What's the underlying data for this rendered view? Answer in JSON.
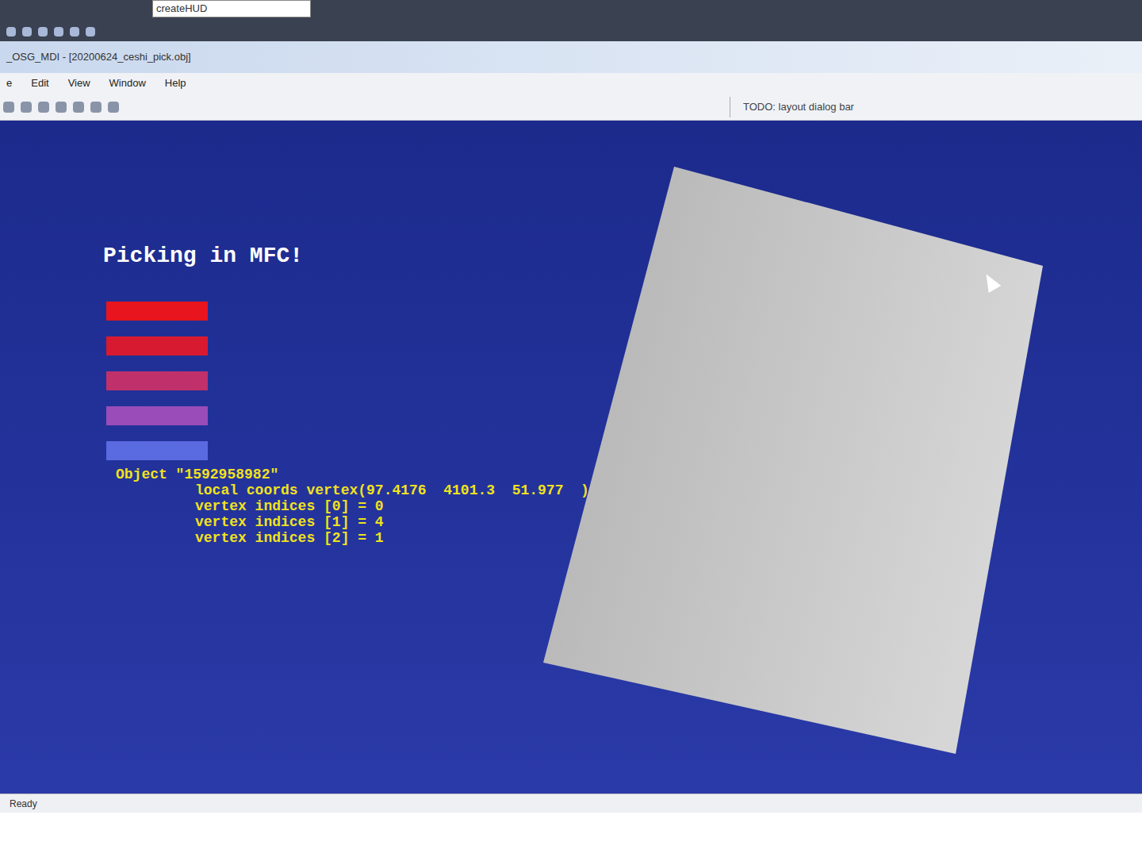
{
  "toolbar_top": {
    "combo": "createHUD"
  },
  "window": {
    "title": "_OSG_MDI - [20200624_ceshi_pick.obj]"
  },
  "menu": [
    "e",
    "Edit",
    "View",
    "Window",
    "Help"
  ],
  "dialog_bar": "TODO: layout dialog bar",
  "hud": {
    "title": "Picking in MFC!",
    "bars": [
      {
        "color": "#e8141e"
      },
      {
        "color": "#d81a30"
      },
      {
        "color": "#c0306a"
      },
      {
        "color": "#9a4cb8"
      },
      {
        "color": "#5a6ae0"
      }
    ],
    "info": [
      "Object \"1592958982\"",
      "local coords vertex(97.4176  4101.3  51.977  )",
      "vertex indices [0] = 0",
      "vertex indices [1] = 4",
      "vertex indices [2] = 1"
    ]
  },
  "status_bar": "Ready"
}
